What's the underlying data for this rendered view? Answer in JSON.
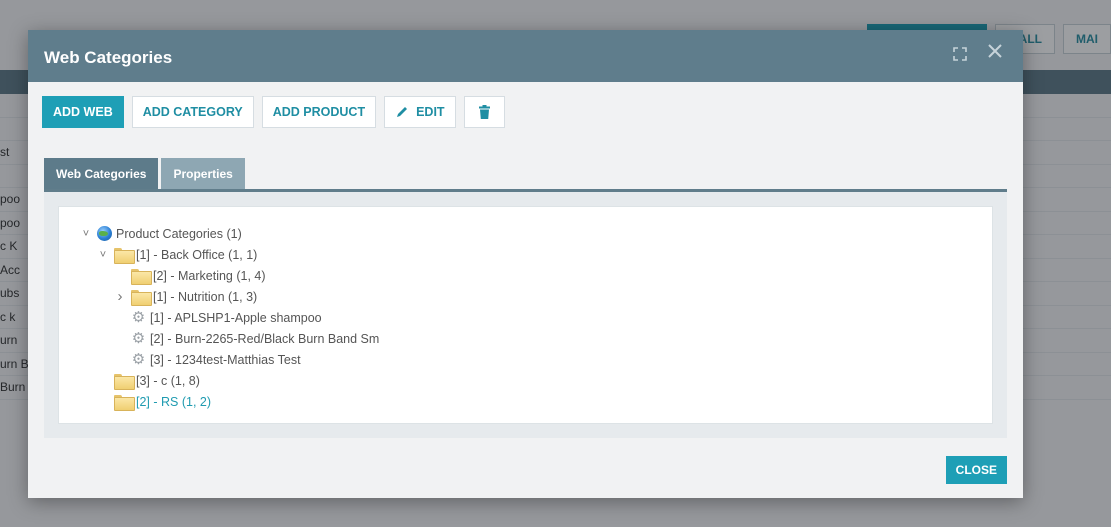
{
  "background": {
    "top_buttons": [
      "",
      "V ALL",
      "MAI"
    ],
    "rows": [
      "",
      "",
      "st",
      "",
      "poo",
      "poo",
      "c K",
      "Acc",
      "ubs",
      "c k",
      "urn",
      "urn Band XL",
      "Burn Band Sm"
    ]
  },
  "modal": {
    "title": "Web Categories",
    "toolbar": {
      "add_web": "ADD WEB",
      "add_category": "ADD CATEGORY",
      "add_product": "ADD PRODUCT",
      "edit": "EDIT"
    },
    "tabs": [
      {
        "label": "Web Categories",
        "active": true
      },
      {
        "label": "Properties",
        "active": false
      }
    ],
    "tree": [
      {
        "label": "Product Categories (1)",
        "icon": "globe-icon",
        "level": 0,
        "toggle": "expanded"
      },
      {
        "label": "[1] - Back Office (1, 1)",
        "icon": "folder-icon",
        "level": 1,
        "toggle": "expanded"
      },
      {
        "label": "[2] - Marketing (1, 4)",
        "icon": "folder-icon",
        "level": 2,
        "toggle": "none"
      },
      {
        "label": "[1] - Nutrition (1, 3)",
        "icon": "folder-icon",
        "level": 2,
        "toggle": "collapsed"
      },
      {
        "label": "[1] - APLSHP1-Apple shampoo",
        "icon": "gear-icon",
        "level": 2,
        "toggle": "none"
      },
      {
        "label": "[2] - Burn-2265-Red/Black Burn Band Sm",
        "icon": "gear-icon",
        "level": 2,
        "toggle": "none"
      },
      {
        "label": "[3] - 1234test-Matthias Test",
        "icon": "gear-icon",
        "level": 2,
        "toggle": "none"
      },
      {
        "label": "[3] - c (1, 8)",
        "icon": "folder-icon",
        "level": 1,
        "toggle": "none"
      },
      {
        "label": "[2] - RS (1, 2)",
        "icon": "folder-icon",
        "level": 1,
        "toggle": "none",
        "highlight": true
      }
    ],
    "close_label": "CLOSE"
  },
  "colors": {
    "header": "#5f7d8c",
    "accent": "#1e9fb6",
    "link": "#1f9bb0"
  }
}
